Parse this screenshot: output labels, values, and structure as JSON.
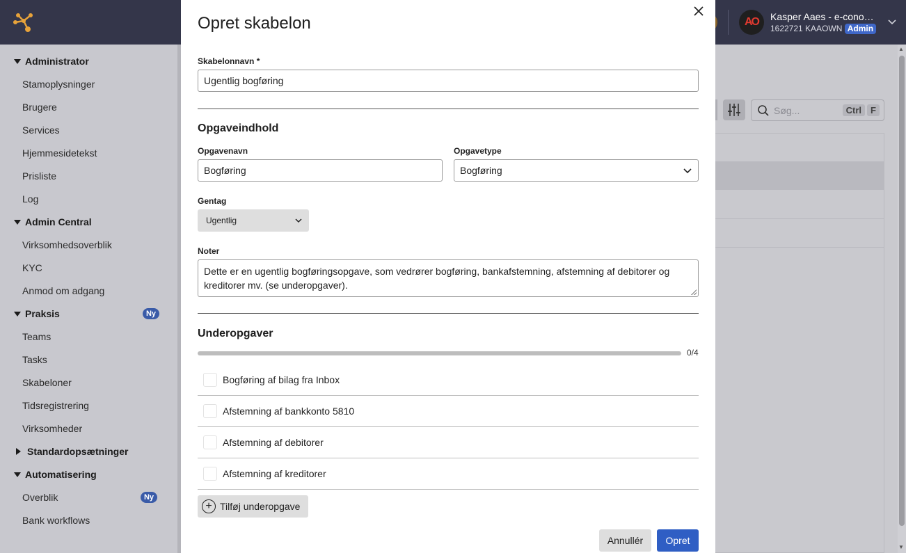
{
  "user": {
    "initials": "AO",
    "name": "Kasper Aaes - e-conomic",
    "id_line": "1622721 KAAOWN",
    "role_badge": "Admin"
  },
  "sidebar": {
    "sections": [
      {
        "label": "Administrator",
        "expanded": true,
        "items": [
          "Stamoplysninger",
          "Brugere",
          "Services",
          "Hjemmesidetekst",
          "Prisliste",
          "Log"
        ]
      },
      {
        "label": "Admin Central",
        "expanded": true,
        "items": [
          "Virksomhedsoverblik",
          "KYC",
          "Anmod om adgang"
        ]
      },
      {
        "label": "Praksis",
        "expanded": true,
        "badge": "Ny",
        "items": [
          "Teams",
          "Tasks",
          "Skabeloner",
          "Tidsregistrering",
          "Virksomheder"
        ]
      },
      {
        "label": "Standardopsætninger",
        "expanded": false,
        "items": []
      },
      {
        "label": "Automatisering",
        "expanded": true,
        "items": [
          "Overblik",
          "Bank workflows"
        ],
        "item_badges": {
          "Overblik": "Ny"
        }
      }
    ]
  },
  "background": {
    "search_placeholder": "Søg...",
    "shortcut_keys": [
      "Ctrl",
      "F"
    ]
  },
  "modal": {
    "title": "Opret skabelon",
    "template_name_label": "Skabelonnavn *",
    "template_name_value": "Ugentlig bogføring",
    "task_content_heading": "Opgaveindhold",
    "task_name_label": "Opgavenavn",
    "task_name_value": "Bogføring",
    "task_type_label": "Opgavetype",
    "task_type_value": "Bogføring",
    "repeat_label": "Gentag",
    "repeat_value": "Ugentlig",
    "notes_label": "Noter",
    "notes_value": "Dette er en ugentlig bogføringsopgave, som vedrører bogføring, bankafstemning, afstemning af debitorer og kreditorer mv. (se underopgaver).",
    "subtasks_heading": "Underopgaver",
    "subtasks_progress": {
      "done": 0,
      "total": 4,
      "text": "0/4"
    },
    "subtasks": [
      {
        "label": "Bogføring af bilag fra Inbox",
        "checked": false
      },
      {
        "label": "Afstemning af bankkonto 5810",
        "checked": false
      },
      {
        "label": "Afstemning af debitorer",
        "checked": false
      },
      {
        "label": "Afstemning af kreditorer",
        "checked": false
      }
    ],
    "add_subtask_label": "Tilføj underopgave",
    "cancel_label": "Annullér",
    "create_label": "Opret"
  }
}
